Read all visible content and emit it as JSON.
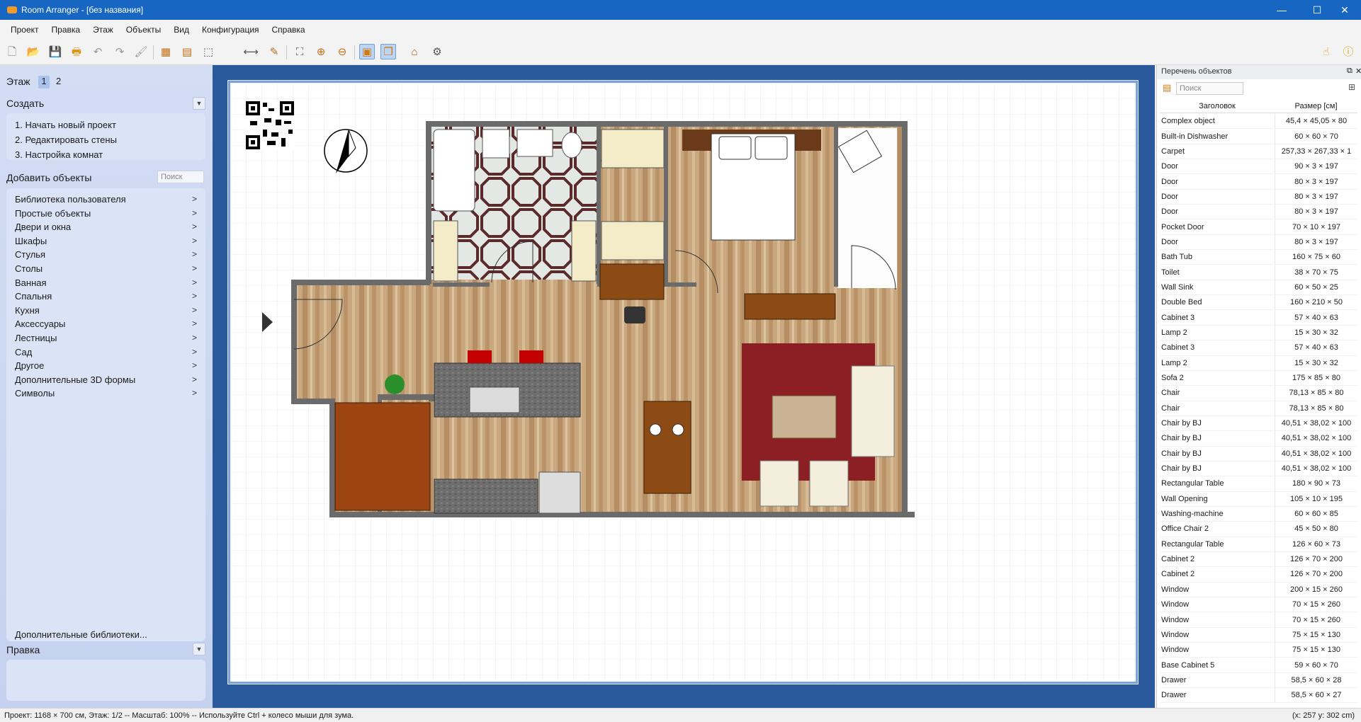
{
  "window": {
    "title": "Room Arranger - [без названия]",
    "minimize": "—",
    "maximize": "☐",
    "close": "✕"
  },
  "menu": [
    "Проект",
    "Правка",
    "Этаж",
    "Объекты",
    "Вид",
    "Конфигурация",
    "Справка"
  ],
  "left": {
    "floor_label": "Этаж",
    "floor_tabs": [
      "1",
      "2"
    ],
    "create_label": "Создать",
    "create_items": [
      "1. Начать новый проект",
      "2. Редактировать стены",
      "3. Настройка комнат"
    ],
    "add_objects_label": "Добавить объекты",
    "search_placeholder": "Поиск",
    "categories": [
      "Библиотека пользователя",
      "Простые объекты",
      "Двери и окна",
      "Шкафы",
      "Стулья",
      "Столы",
      "Ванная",
      "Спальня",
      "Кухня",
      "Аксессуары",
      "Лестницы",
      "Сад",
      "Другое",
      "Дополнительные 3D формы",
      "Символы"
    ],
    "more_libraries": "Дополнительные библиотеки...",
    "edit_label": "Правка"
  },
  "right_panel": {
    "title": "Перечень объектов",
    "search_placeholder": "Поиск",
    "col_title": "Заголовок",
    "col_size": "Размер [см]",
    "rows": [
      [
        "Complex object",
        "45,4 × 45,05 × 80"
      ],
      [
        "Built-in Dishwasher",
        "60 × 60 × 70"
      ],
      [
        "Carpet",
        "257,33 × 267,33 × 1"
      ],
      [
        "Door",
        "90 × 3 × 197"
      ],
      [
        "Door",
        "80 × 3 × 197"
      ],
      [
        "Door",
        "80 × 3 × 197"
      ],
      [
        "Door",
        "80 × 3 × 197"
      ],
      [
        "Pocket Door",
        "70 × 10 × 197"
      ],
      [
        "Door",
        "80 × 3 × 197"
      ],
      [
        "Bath Tub",
        "160 × 75 × 60"
      ],
      [
        "Toilet",
        "38 × 70 × 75"
      ],
      [
        "Wall Sink",
        "60 × 50 × 25"
      ],
      [
        "Double Bed",
        "160 × 210 × 50"
      ],
      [
        "Cabinet 3",
        "57 × 40 × 63"
      ],
      [
        "Lamp 2",
        "15 × 30 × 32"
      ],
      [
        "Cabinet 3",
        "57 × 40 × 63"
      ],
      [
        "Lamp 2",
        "15 × 30 × 32"
      ],
      [
        "Sofa 2",
        "175 × 85 × 80"
      ],
      [
        "Chair",
        "78,13 × 85 × 80"
      ],
      [
        "Chair",
        "78,13 × 85 × 80"
      ],
      [
        "Chair by BJ",
        "40,51 × 38,02 × 100"
      ],
      [
        "Chair by BJ",
        "40,51 × 38,02 × 100"
      ],
      [
        "Chair by BJ",
        "40,51 × 38,02 × 100"
      ],
      [
        "Chair by BJ",
        "40,51 × 38,02 × 100"
      ],
      [
        "Rectangular Table",
        "180 × 90 × 73"
      ],
      [
        "Wall Opening",
        "105 × 10 × 195"
      ],
      [
        "Washing-machine",
        "60 × 60 × 85"
      ],
      [
        "Office Chair 2",
        "45 × 50 × 80"
      ],
      [
        "Rectangular Table",
        "126 × 60 × 73"
      ],
      [
        "Cabinet 2",
        "126 × 70 × 200"
      ],
      [
        "Cabinet 2",
        "126 × 70 × 200"
      ],
      [
        "Window",
        "200 × 15 × 260"
      ],
      [
        "Window",
        "70 × 15 × 260"
      ],
      [
        "Window",
        "70 × 15 × 260"
      ],
      [
        "Window",
        "75 × 15 × 130"
      ],
      [
        "Window",
        "75 × 15 × 130"
      ],
      [
        "Base Cabinet 5",
        "59 × 60 × 70"
      ],
      [
        "Drawer",
        "58,5 × 60 × 28"
      ],
      [
        "Drawer",
        "58,5 × 60 × 27"
      ]
    ]
  },
  "status": {
    "left": "Проект: 1168 × 700 см, Этаж: 1/2 -- Масштаб: 100% -- Используйте Ctrl + колесо мыши для зума.",
    "right": "(x: 257 y: 302 cm)"
  },
  "colors": {
    "titlebar": "#1767c2",
    "canvas_bg": "#2a5a9c",
    "floor": "#c9a77f",
    "carpet": "#8c1f24",
    "wall": "#6b6b6b"
  }
}
